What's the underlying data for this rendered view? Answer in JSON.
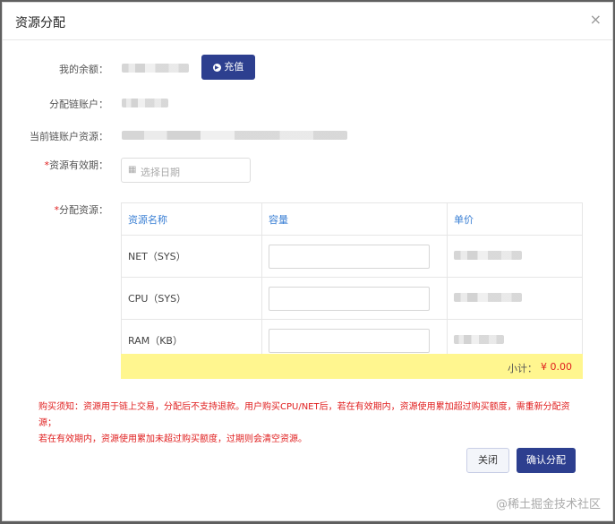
{
  "dialog": {
    "title": "资源分配",
    "close_icon": "×"
  },
  "form": {
    "balance_label": "我的余额：",
    "recharge_label": "充值",
    "account_label": "分配链账户：",
    "current_resources_label": "当前链账户资源：",
    "validity_label": "资源有效期：",
    "date_placeholder": "选择日期",
    "allocate_label": "分配资源："
  },
  "table": {
    "headers": [
      "资源名称",
      "容量",
      "单价"
    ],
    "rows": [
      {
        "name": "NET（SYS）"
      },
      {
        "name": "CPU（SYS）"
      },
      {
        "name": "RAM（KB）"
      }
    ],
    "subtotal_label": "小计：",
    "subtotal_value": "¥ 0.00"
  },
  "notice": {
    "line1": "购买须知：资源用于链上交易，分配后不支持退款。用户购买CPU/NET后，若在有效期内，资源使用累加超过购买额度，需重新分配资源；",
    "line2": "若在有效期内，资源使用累加未超过购买额度，过期则会清空资源。"
  },
  "footer": {
    "cancel_label": "关闭",
    "confirm_label": "确认分配"
  },
  "watermark": "@稀土掘金技术社区"
}
